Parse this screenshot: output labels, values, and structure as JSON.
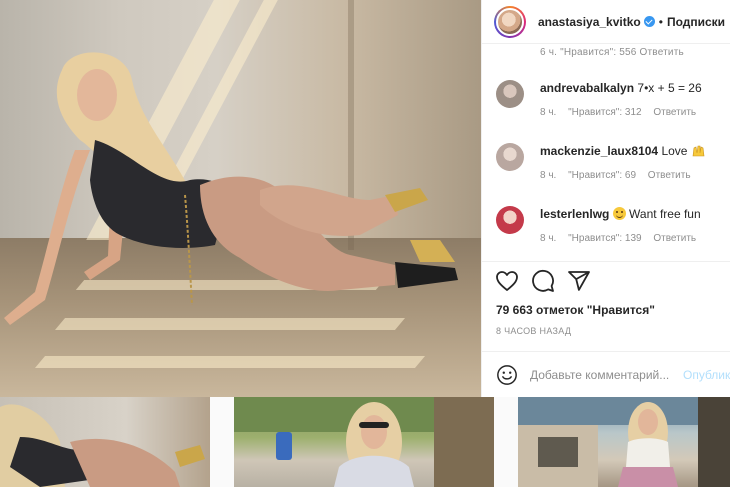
{
  "post": {
    "image_alt": "Фото публикации",
    "author": {
      "username": "anastasiya_kvitko",
      "verified": true,
      "follow_label": "Подписки",
      "separator": "•"
    }
  },
  "partial_comment_meta": "6 ч.   \"Нравится\": 556   Ответить",
  "comments": [
    {
      "username": "andrevabalkalyn",
      "text": "7•x + 5 = 26",
      "time": "8 ч.",
      "likes": "\"Нравится\": 312",
      "reply": "Ответить",
      "avatar_color": "#9c8f86"
    },
    {
      "username": "mackenzie_laux8104",
      "text": "Love",
      "emoji": "raising-hands-icon",
      "time": "8 ч.",
      "likes": "\"Нравится\": 69",
      "reply": "Ответить",
      "avatar_color": "#b9a7a0"
    },
    {
      "username": "lesterlenlwg",
      "emoji": "hugging-face-icon",
      "text": "Want free fun",
      "time": "8 ч.",
      "likes": "\"Нравится\": 139",
      "reply": "Ответить",
      "avatar_color": "#c43a4a"
    }
  ],
  "actions": {
    "like_icon": "heart-icon",
    "comment_icon": "comment-icon",
    "share_icon": "paper-plane-icon"
  },
  "likes_text": "79 663 отметок \"Нравится\"",
  "time_ago": "8 ЧАСОВ НАЗАД",
  "comment_box": {
    "placeholder": "Добавьте комментарий...",
    "publish_label": "Опубликовать",
    "emoji_icon": "smiley-icon"
  },
  "colors": {
    "link_blue": "#3897f0",
    "publish_disabled": "#b2dffc",
    "meta_gray": "#8e8e8e"
  },
  "grid_thumbnails": [
    {
      "name": "thumbnail-1"
    },
    {
      "name": "thumbnail-2"
    },
    {
      "name": "thumbnail-3"
    }
  ]
}
